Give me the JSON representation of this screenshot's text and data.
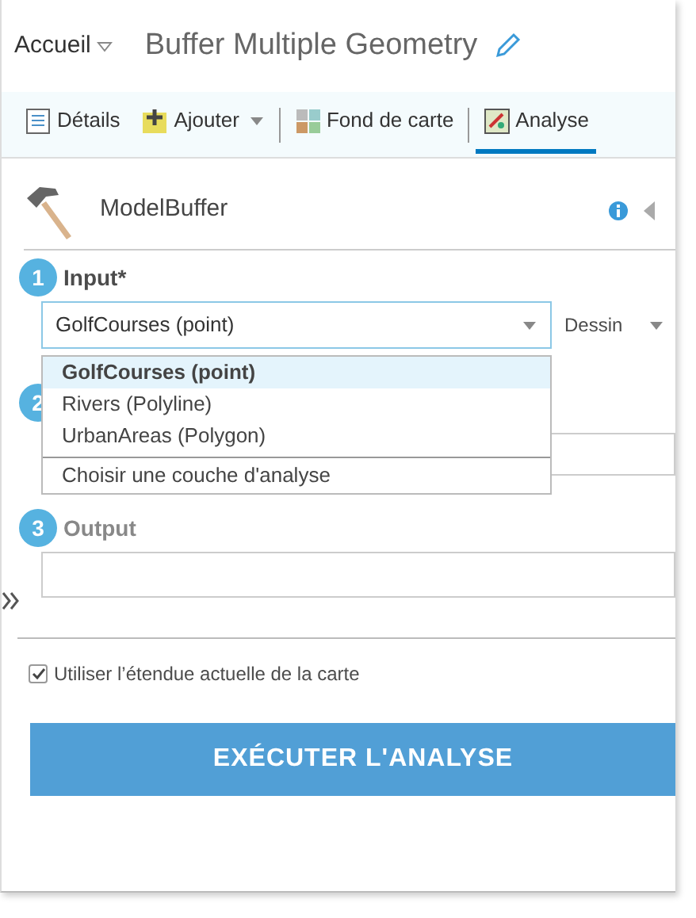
{
  "header": {
    "home": "Accueil",
    "title": "Buffer Multiple Geometry"
  },
  "tabs": [
    {
      "label": "Détails",
      "caret": false,
      "selected": false
    },
    {
      "label": "Ajouter",
      "caret": true,
      "selected": false
    },
    {
      "label": "Fond de carte",
      "caret": false,
      "selected": false
    },
    {
      "label": "Analyse",
      "caret": false,
      "selected": true
    }
  ],
  "tool": {
    "name": "ModelBuffer"
  },
  "steps": [
    {
      "number": "1",
      "label": "Input*",
      "kind": "select",
      "value": "GolfCourses (point)",
      "extra": "Dessin"
    },
    {
      "number": "2",
      "kind": "hidden"
    },
    {
      "number": "3",
      "label": "Output",
      "kind": "text"
    }
  ],
  "dropdown": {
    "options": [
      {
        "label": "GolfCourses (point)",
        "selected": true
      },
      {
        "label": "Rivers (Polyline)",
        "selected": false
      },
      {
        "label": "UrbanAreas (Polygon)",
        "selected": false
      }
    ],
    "footer": "Choisir une couche d'analyse"
  },
  "extent": {
    "label": "Utiliser l’étendue actuelle de la carte",
    "checked": true
  },
  "run_button": "EXÉCUTER L'ANALYSE"
}
